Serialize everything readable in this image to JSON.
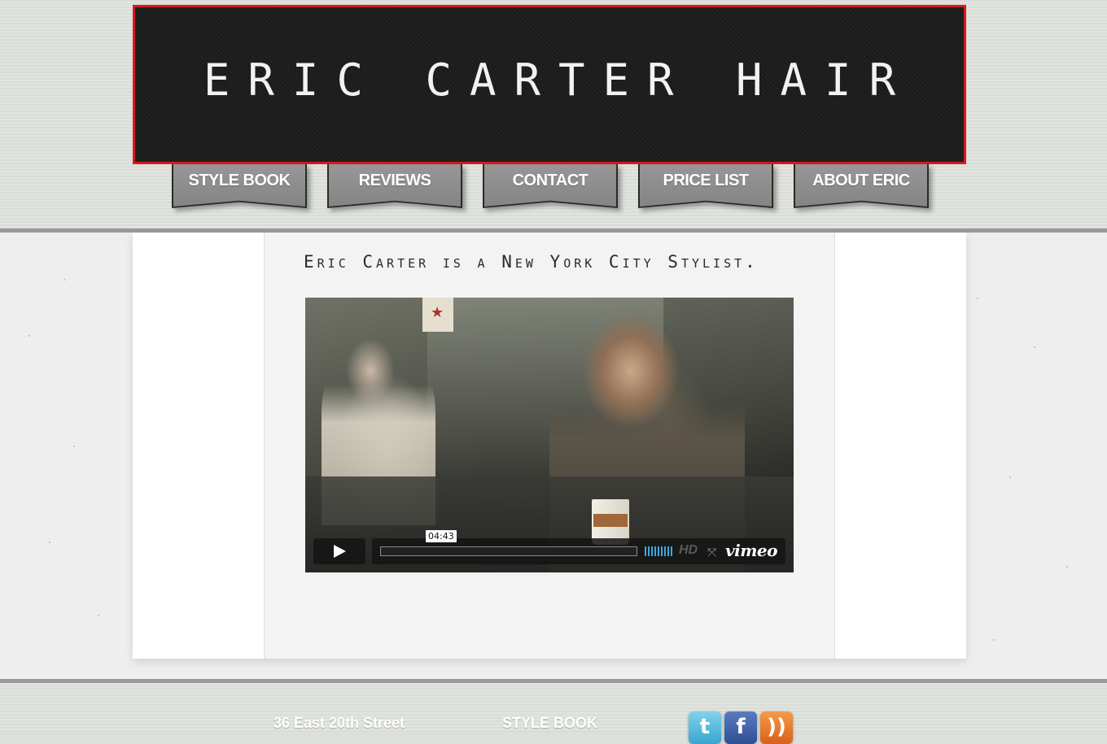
{
  "header": {
    "title": "ERIC CARTER HAIR"
  },
  "nav": {
    "items": [
      {
        "label": "STYLE BOOK"
      },
      {
        "label": "REVIEWS"
      },
      {
        "label": "CONTACT"
      },
      {
        "label": "PRICE LIST"
      },
      {
        "label": "ABOUT ERIC"
      }
    ]
  },
  "main": {
    "tagline": "Eric Carter is a New York City Stylist.",
    "video": {
      "duration": "04:43",
      "hd_label": "HD",
      "provider": "vimeo",
      "icons": [
        "play-icon",
        "volume-icon",
        "fullscreen-icon"
      ]
    }
  },
  "footer": {
    "address": "36 East 20th Street",
    "link": "STYLE BOOK",
    "social_icons": [
      "twitter-icon",
      "facebook-icon",
      "rss-icon"
    ]
  },
  "colors": {
    "banner_background": "#1c1c1c",
    "banner_border": "#d9191f",
    "tab_gray": "#8c8c8c",
    "volume_blue": "#3ea8e0"
  }
}
